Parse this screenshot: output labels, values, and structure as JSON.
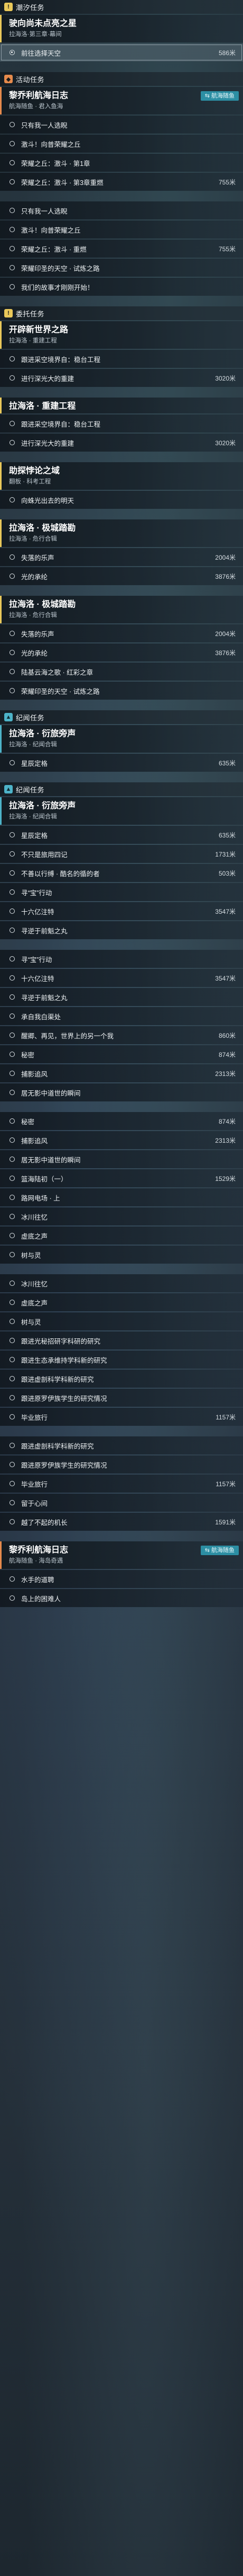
{
  "sections_icon": {
    "main": "!",
    "event": "◆",
    "world": "▲"
  },
  "rows": [
    {
      "type": "section",
      "theme": "main",
      "label": "潮汐任务"
    },
    {
      "type": "quest",
      "theme": "main",
      "title": "驶向尚未点亮之星",
      "subtitle": "拉海洛·第三章·幕间"
    },
    {
      "type": "objective",
      "text": "前往选择天空",
      "dist": "586米",
      "active": true
    },
    {
      "type": "gap"
    },
    {
      "type": "section",
      "theme": "event",
      "label": "活动任务"
    },
    {
      "type": "quest",
      "theme": "event",
      "title": "黎乔利航海日志",
      "subtitle": "航海随鱼 · 君入鱼海",
      "badge": "⇆ 航海随鱼"
    },
    {
      "type": "objective",
      "text": "只有我一人选睨",
      "dist": ""
    },
    {
      "type": "objective",
      "text": "激斗！向普荣耀之丘",
      "dist": ""
    },
    {
      "type": "objective",
      "text": "荣耀之丘：激斗 · 第1章",
      "dist": ""
    },
    {
      "type": "objective",
      "text": "荣耀之丘：激斗 · 第3章重燃",
      "dist": "755米"
    },
    {
      "type": "gap"
    },
    {
      "type": "objective",
      "text": "只有我一人选睨",
      "dist": ""
    },
    {
      "type": "objective",
      "text": "激斗！向普荣耀之丘",
      "dist": ""
    },
    {
      "type": "objective",
      "text": "荣耀之丘：激斗 · 重燃",
      "dist": "755米"
    },
    {
      "type": "objective",
      "text": "荣耀印圣的天空 · 试炼之路",
      "dist": ""
    },
    {
      "type": "objective",
      "text": "我们的故事才刚刚开始！",
      "dist": ""
    },
    {
      "type": "gap"
    },
    {
      "type": "section",
      "theme": "main",
      "label": "委托任务"
    },
    {
      "type": "quest",
      "theme": "main",
      "title": "开辟新世界之路",
      "subtitle": "拉海洛 · 重建工程"
    },
    {
      "type": "objective",
      "text": "跟进采空境界自：稳台工程",
      "dist": ""
    },
    {
      "type": "objective",
      "text": "进行深光大的重建",
      "dist": "3020米"
    },
    {
      "type": "gap"
    },
    {
      "type": "quest",
      "theme": "main",
      "title": "拉海洛 · 重建工程",
      "subtitle": "",
      "small": true
    },
    {
      "type": "objective",
      "text": "跟进采空境界自：稳台工程",
      "dist": ""
    },
    {
      "type": "objective",
      "text": "进行深光大的重建",
      "dist": "3020米"
    },
    {
      "type": "gap"
    },
    {
      "type": "quest",
      "theme": "main",
      "title": "助探悖论之域",
      "subtitle": "翻板 · 科考工程"
    },
    {
      "type": "objective",
      "text": "向蛛光出去的明天",
      "dist": ""
    },
    {
      "type": "gap"
    },
    {
      "type": "quest",
      "theme": "main",
      "title": "拉海洛 · 极城踏勘",
      "subtitle": "拉海洛 · 危行合辑"
    },
    {
      "type": "objective",
      "text": "失落的乐声",
      "dist": "2004米"
    },
    {
      "type": "objective",
      "text": "光的承纶",
      "dist": "3876米"
    },
    {
      "type": "gap"
    },
    {
      "type": "quest",
      "theme": "main",
      "title": "拉海洛 · 极城踏勘",
      "subtitle": "拉海洛 · 危行合辑"
    },
    {
      "type": "objective",
      "text": "失落的乐声",
      "dist": "2004米"
    },
    {
      "type": "objective",
      "text": "光的承纶",
      "dist": "3876米"
    },
    {
      "type": "objective",
      "text": "陆基云海之歌 · 红彩之章",
      "dist": ""
    },
    {
      "type": "objective",
      "text": "荣耀印圣的天空 · 试炼之路",
      "dist": ""
    },
    {
      "type": "gap"
    },
    {
      "type": "section",
      "theme": "world",
      "label": "纪闻任务"
    },
    {
      "type": "quest",
      "theme": "world",
      "title": "拉海洛 · 衍旅旁声",
      "subtitle": "拉海洛 · 纪闻合辑"
    },
    {
      "type": "objective",
      "text": "星辰定格",
      "dist": "635米"
    },
    {
      "type": "gap"
    },
    {
      "type": "section",
      "theme": "world",
      "label": "纪闻任务"
    },
    {
      "type": "quest",
      "theme": "world",
      "title": "拉海洛 · 衍旅旁声",
      "subtitle": "拉海洛 · 纪闻合辑"
    },
    {
      "type": "objective",
      "text": "星辰定格",
      "dist": "635米"
    },
    {
      "type": "objective",
      "text": "不只是旅用四记",
      "dist": "1731米"
    },
    {
      "type": "objective",
      "text": "不善以行缚 · 酷名的循的者",
      "dist": "503米"
    },
    {
      "type": "objective",
      "text": "寻“宝”行动",
      "dist": ""
    },
    {
      "type": "objective",
      "text": "十六亿注特",
      "dist": "3547米"
    },
    {
      "type": "objective",
      "text": "寻逆于前魁之丸",
      "dist": ""
    },
    {
      "type": "gap"
    },
    {
      "type": "objective",
      "text": "寻“宝”行动",
      "dist": ""
    },
    {
      "type": "objective",
      "text": "十六亿注特",
      "dist": "3547米"
    },
    {
      "type": "objective",
      "text": "寻逆于前魁之丸",
      "dist": ""
    },
    {
      "type": "objective",
      "text": "承自我白渠处",
      "dist": ""
    },
    {
      "type": "objective",
      "text": "醒卿、再见，世界上的另一个我",
      "dist": "860米"
    },
    {
      "type": "objective",
      "text": "秘密",
      "dist": "874米"
    },
    {
      "type": "objective",
      "text": "捕影追风",
      "dist": "2313米"
    },
    {
      "type": "objective",
      "text": "居无影中道世的瞬间",
      "dist": ""
    },
    {
      "type": "gap"
    },
    {
      "type": "objective",
      "text": "秘密",
      "dist": "874米"
    },
    {
      "type": "objective",
      "text": "捕影追风",
      "dist": "2313米"
    },
    {
      "type": "objective",
      "text": "居无影中道世的瞬间",
      "dist": ""
    },
    {
      "type": "objective",
      "text": "篮海陆初（一）",
      "dist": "1529米"
    },
    {
      "type": "objective",
      "text": "路网电场 · 上",
      "dist": ""
    },
    {
      "type": "objective",
      "text": "冰川往忆",
      "dist": ""
    },
    {
      "type": "objective",
      "text": "虚底之声",
      "dist": ""
    },
    {
      "type": "objective",
      "text": "树与灵",
      "dist": ""
    },
    {
      "type": "gap"
    },
    {
      "type": "objective",
      "text": "冰川往忆",
      "dist": ""
    },
    {
      "type": "objective",
      "text": "虚底之声",
      "dist": ""
    },
    {
      "type": "objective",
      "text": "树与灵",
      "dist": ""
    },
    {
      "type": "objective",
      "text": "跟进光秘招研字科研的研究",
      "dist": ""
    },
    {
      "type": "objective",
      "text": "跟进生态承维持学科新的研究",
      "dist": ""
    },
    {
      "type": "objective",
      "text": "跟进虚剖科学科新的研究",
      "dist": ""
    },
    {
      "type": "objective",
      "text": "跟进原罗伊族学生的研究情况",
      "dist": ""
    },
    {
      "type": "objective",
      "text": "毕业旅行",
      "dist": "1157米"
    },
    {
      "type": "gap"
    },
    {
      "type": "objective",
      "text": "跟进虚剖科学科新的研究",
      "dist": ""
    },
    {
      "type": "objective",
      "text": "跟进原罗伊族学生的研究情况",
      "dist": ""
    },
    {
      "type": "objective",
      "text": "毕业旅行",
      "dist": "1157米"
    },
    {
      "type": "objective",
      "text": "留于心间",
      "dist": ""
    },
    {
      "type": "objective",
      "text": "越了不起的机长",
      "dist": "1591米"
    },
    {
      "type": "gap"
    },
    {
      "type": "quest",
      "theme": "event",
      "title": "黎乔利航海日志",
      "subtitle": "航海随鱼 · 海岛奇遇",
      "badge": "⇆ 航海随鱼"
    },
    {
      "type": "objective",
      "text": "水手的道聘",
      "dist": ""
    },
    {
      "type": "objective",
      "text": "岛上的困难人",
      "dist": ""
    }
  ]
}
